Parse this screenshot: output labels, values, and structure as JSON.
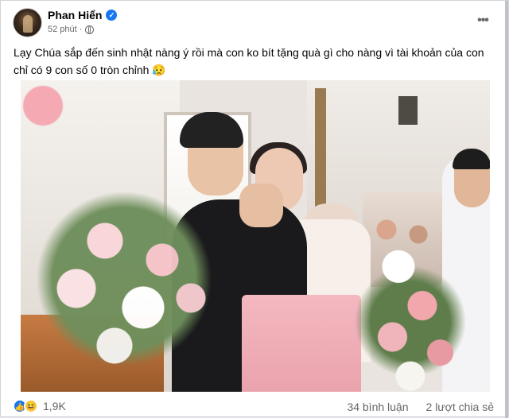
{
  "post": {
    "author": "Phan Hiển",
    "time": "52 phút ·",
    "more_label": "•••",
    "text": "Lạy Chúa sắp đến sinh nhật nàng ý rồi mà con ko bít tặng quà gì cho nàng vì tài khoản của con chỉ có 9 con số 0 tròn chỉnh 😥"
  },
  "icons": {
    "verified": "verified-badge-icon",
    "privacy": "globe-icon",
    "more": "more-options-icon",
    "like": "like-reaction-icon",
    "haha": "haha-reaction-icon"
  },
  "footer": {
    "like_glyph": "👍",
    "haha_glyph": "😆",
    "reaction_count": "1,9K",
    "comments": "34 bình luận",
    "shares": "2 lượt chia sẻ"
  },
  "colors": {
    "accent": "#1877f2",
    "secondary_text": "#65676b"
  }
}
